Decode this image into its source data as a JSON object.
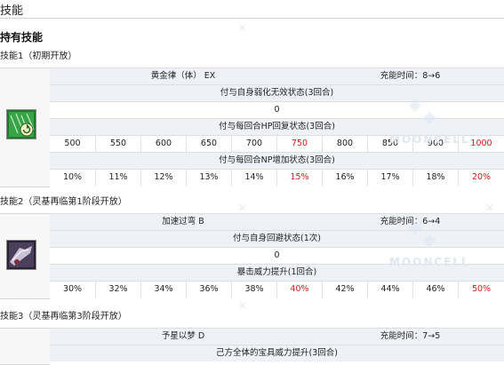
{
  "page_title": "技能",
  "section_title": "持有技能",
  "watermark": "MOONCELL",
  "skills": [
    {
      "heading": "技能1（初期开放）",
      "name": "黄金律（体） EX",
      "cooldown": "充能时间：8→6",
      "effect1": "付与自身弱化无效状态(3回合)",
      "effect1_value": "0",
      "effect2": "付与每回合HP回复状态(3回合)",
      "effect2_values": [
        "500",
        "550",
        "600",
        "650",
        "700",
        "750",
        "800",
        "850",
        "900",
        "1000"
      ],
      "effect3": "付与每回合NP增加状态(3回合)",
      "effect3_values": [
        "10%",
        "11%",
        "12%",
        "13%",
        "14%",
        "15%",
        "16%",
        "17%",
        "18%",
        "20%"
      ]
    },
    {
      "heading": "技能2（灵基再临第1阶段开放）",
      "name": "加速过弯 B",
      "cooldown": "充能时间：6→4",
      "effect1": "付与自身回避状态(1次)",
      "effect1_value": "0",
      "effect2": "暴击威力提升(1回合)",
      "effect2_values": [
        "30%",
        "32%",
        "34%",
        "36%",
        "38%",
        "40%",
        "42%",
        "44%",
        "46%",
        "50%"
      ]
    },
    {
      "heading": "技能3（灵基再临第3阶段开放）",
      "name": "予星以梦 D",
      "cooldown": "充能时间：7→5",
      "effect1": "己方全体的宝具威力提升(3回合)"
    }
  ]
}
